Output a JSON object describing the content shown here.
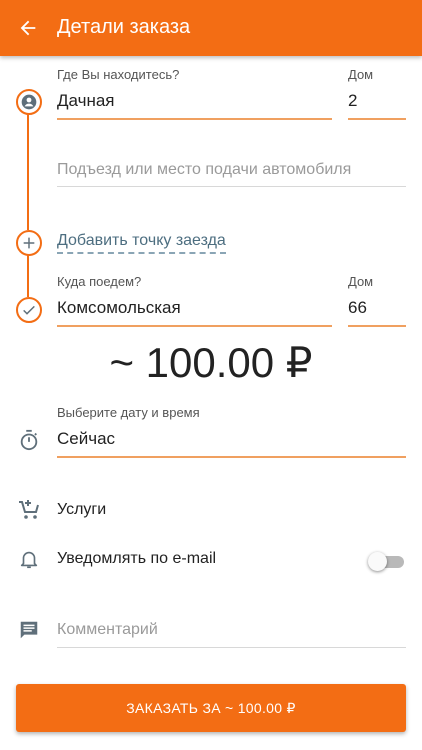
{
  "header": {
    "title": "Детали заказа",
    "back_icon": "arrow-left-icon"
  },
  "from": {
    "label": "Где Вы находитесь?",
    "street": "Дачная",
    "house_label": "Дом",
    "house": "2",
    "entrance_placeholder": "Подъезд или место подачи автомобиля"
  },
  "add_stop": "Добавить точку заезда",
  "to": {
    "label": "Куда поедем?",
    "street": "Комсомольская",
    "house_label": "Дом",
    "house": "66"
  },
  "price": "~ 100.00 ₽",
  "datetime": {
    "label": "Выберите дату и время",
    "value": "Сейчас"
  },
  "services": {
    "label": "Услуги"
  },
  "email_notify": {
    "label": "Уведомлять по e-mail",
    "enabled": false
  },
  "comment": {
    "placeholder": "Комментарий"
  },
  "order_button": "ЗАКАЗАТЬ ЗА ~ 100.00 ₽",
  "colors": {
    "accent": "#f36d14",
    "link": "#4d6e80",
    "icon_gray": "#5f6f7a"
  }
}
